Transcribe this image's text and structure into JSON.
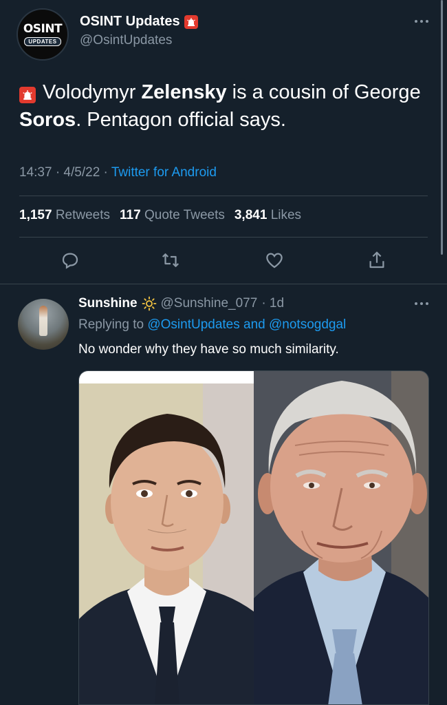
{
  "main_tweet": {
    "author_name": "OSINT Updates",
    "author_handle": "@OsintUpdates",
    "avatar_logo_top": "OSINT",
    "avatar_logo_bottom": "UPDATES",
    "text_part1": "Volodymyr ",
    "text_bold1": "Zelensky",
    "text_part2": " is a cousin of George ",
    "text_bold2": "Soros",
    "text_part3": ". Pentagon official says.",
    "time": "14:37 · 4/5/22 · ",
    "source": "Twitter for Android",
    "retweets_count": "1,157",
    "retweets_label": "Retweets",
    "quotes_count": "117",
    "quotes_label": "Quote Tweets",
    "likes_count": "3,841",
    "likes_label": "Likes",
    "actions": [
      "reply-icon",
      "retweet-icon",
      "like-icon",
      "share-icon"
    ]
  },
  "reply_tweet": {
    "author_name": "Sunshine",
    "author_handle": "@Sunshine_077",
    "time": "· 1d",
    "replying_prefix": "Replying to ",
    "mention1": "@OsintUpdates",
    "and_text": " and ",
    "mention2": "@notsogdgal",
    "text": "No wonder why they have so much similarity."
  },
  "colors": {
    "background": "#15202b",
    "text_secondary": "#8b98a5",
    "link": "#1d9bf0",
    "divider": "#38444d",
    "siren": "#e23a2e"
  }
}
